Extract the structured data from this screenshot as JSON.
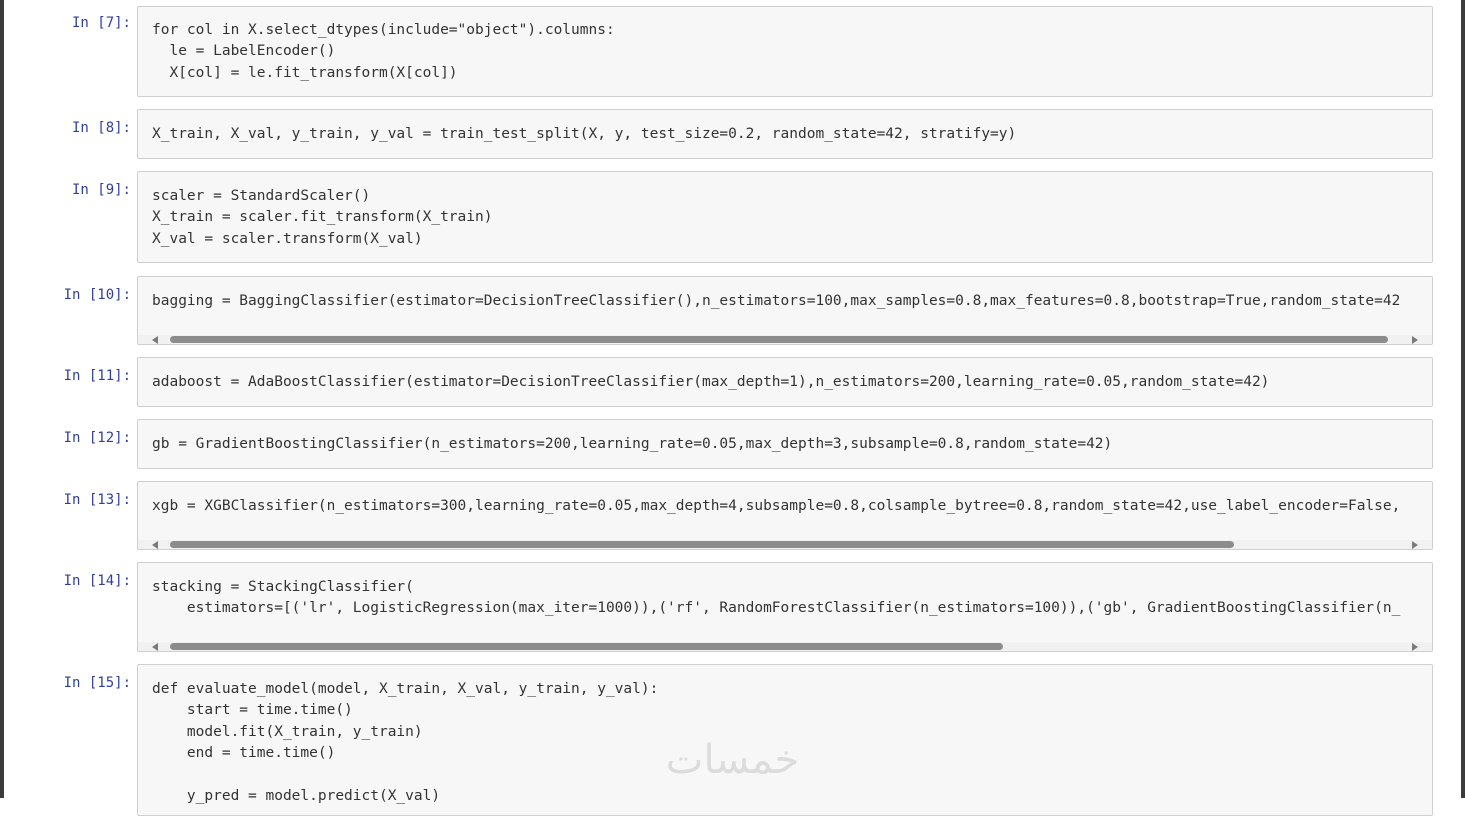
{
  "cells": [
    {
      "prompt": "In [7]:",
      "lines": [
        "for col in X.select_dtypes(include=\"object\").columns:",
        "  le = LabelEncoder()",
        "  X[col] = le.fit_transform(X[col])"
      ]
    },
    {
      "prompt": "In [8]:",
      "lines": [
        "X_train, X_val, y_train, y_val = train_test_split(X, y, test_size=0.2, random_state=42, stratify=y)"
      ]
    },
    {
      "prompt": "In [9]:",
      "lines": [
        "scaler = StandardScaler()",
        "X_train = scaler.fit_transform(X_train)",
        "X_val = scaler.transform(X_val)"
      ]
    },
    {
      "prompt": "In [10]:",
      "lines": [
        "bagging = BaggingClassifier(estimator=DecisionTreeClassifier(),n_estimators=100,max_samples=0.8,max_features=0.8,bootstrap=True,random_state=42"
      ]
    },
    {
      "prompt": "In [11]:",
      "lines": [
        "adaboost = AdaBoostClassifier(estimator=DecisionTreeClassifier(max_depth=1),n_estimators=200,learning_rate=0.05,random_state=42)"
      ]
    },
    {
      "prompt": "In [12]:",
      "lines": [
        "gb = GradientBoostingClassifier(n_estimators=200,learning_rate=0.05,max_depth=3,subsample=0.8,random_state=42)"
      ]
    },
    {
      "prompt": "In [13]:",
      "lines": [
        "xgb = XGBClassifier(n_estimators=300,learning_rate=0.05,max_depth=4,subsample=0.8,colsample_bytree=0.8,random_state=42,use_label_encoder=False,"
      ]
    },
    {
      "prompt": "In [14]:",
      "lines": [
        "stacking = StackingClassifier(",
        "    estimators=[('lr', LogisticRegression(max_iter=1000)),('rf', RandomForestClassifier(n_estimators=100)),('gb', GradientBoostingClassifier(n_"
      ]
    },
    {
      "prompt": "In [15]:",
      "lines": [
        "def evaluate_model(model, X_train, X_val, y_train, y_val):",
        "    start = time.time()",
        "    model.fit(X_train, y_train)",
        "    end = time.time()",
        "",
        "    y_pred = model.predict(X_val)"
      ]
    }
  ],
  "scrollbars": {
    "cell_10_thumb_fraction": 0.95,
    "cell_13_thumb_fraction": 0.83,
    "cell_14_thumb_fraction": 0.65
  },
  "watermark": "خمسات",
  "colors": {
    "prompt": "#303f9f",
    "number": "#a05a00",
    "string": "#1a7a1a",
    "keyword": "#1a5fb4"
  }
}
